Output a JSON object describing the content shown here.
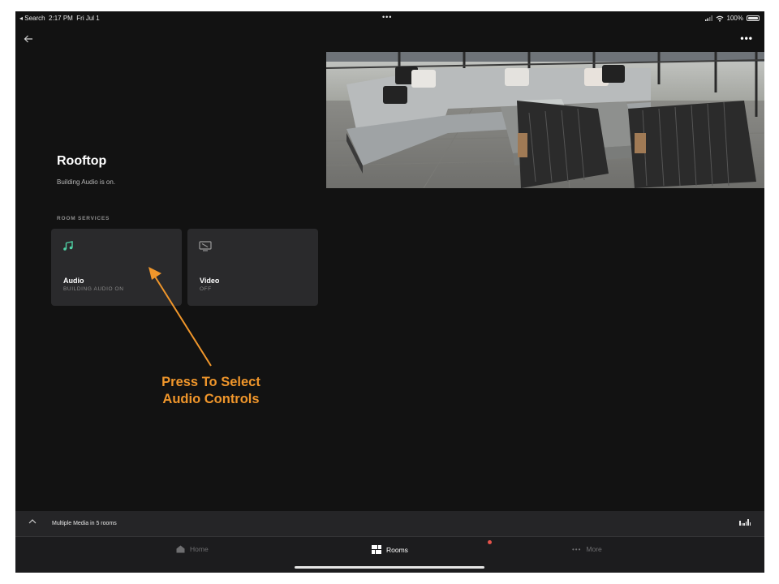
{
  "status_bar": {
    "back_app": "◂ Search",
    "time": "2:17 PM",
    "date": "Fri Jul 1",
    "battery": "100%"
  },
  "room": {
    "title": "Rooftop",
    "status": "Building Audio is on.",
    "section_label": "ROOM SERVICES"
  },
  "services": [
    {
      "title": "Audio",
      "subtitle": "BUILDING AUDIO ON",
      "icon": "music-note-icon",
      "icon_color": "#4fd1a5"
    },
    {
      "title": "Video",
      "subtitle": "OFF",
      "icon": "screen-icon",
      "icon_color": "#9a9a9a"
    }
  ],
  "annotation": {
    "line1": "Press To Select",
    "line2": "Audio Controls",
    "color": "#f0962b"
  },
  "mini_player": {
    "label": "Multiple Media in 5 rooms"
  },
  "tabs": [
    {
      "label": "Home",
      "icon": "home-icon",
      "active": false
    },
    {
      "label": "Rooms",
      "icon": "rooms-grid-icon",
      "active": true
    },
    {
      "label": "More",
      "icon": "more-dots-icon",
      "active": false
    }
  ],
  "colors": {
    "background": "#121212",
    "card": "#2a2a2c",
    "accent_green": "#4fd1a5",
    "badge_red": "#e5534b"
  }
}
